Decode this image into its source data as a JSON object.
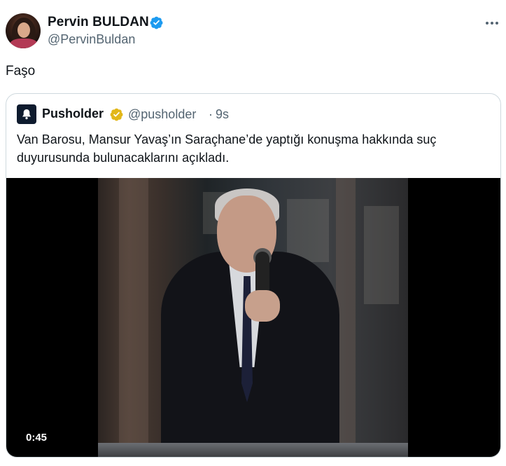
{
  "tweet": {
    "author": {
      "name": "Pervin BULDAN",
      "handle": "@PervinBuldan",
      "avatar_icon": "profile-photo",
      "verified": "blue"
    },
    "text": "Faşo",
    "more_icon": "more-horizontal-icon"
  },
  "quote": {
    "author": {
      "name": "Pusholder",
      "handle": "@pusholder",
      "separator": "·",
      "time": "9s",
      "avatar_icon": "bell-logo",
      "verified": "gold"
    },
    "text": "Van Barosu, Mansur Yavaş’ın Saraçhane’de yaptığı konuşma hakkında suç duyurusunda bulunacaklarını açıkladı.",
    "video": {
      "duration": "0:45"
    }
  },
  "colors": {
    "text_primary": "#0f1419",
    "text_secondary": "#536471",
    "border": "#cfd9de",
    "verified_blue": "#1d9bf0",
    "verified_gold": "#e2b719"
  }
}
